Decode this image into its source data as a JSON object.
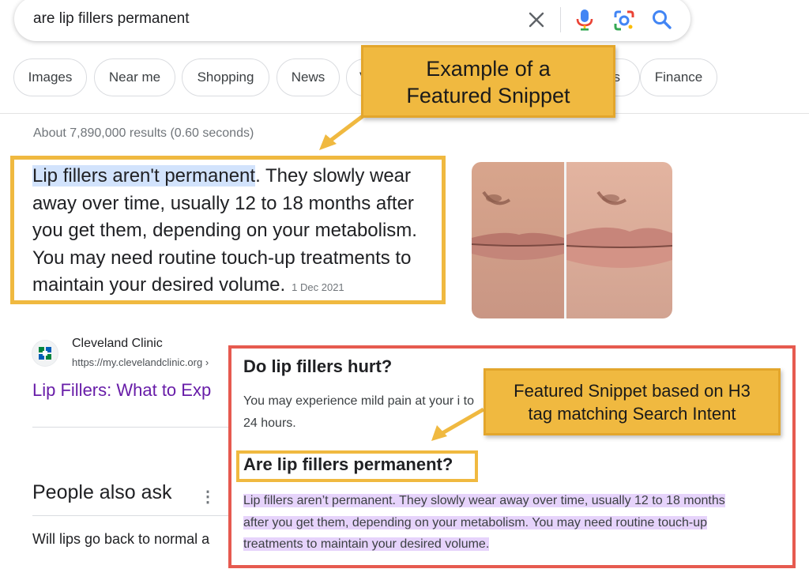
{
  "search": {
    "query": "are lip fillers permanent"
  },
  "chips": [
    "Images",
    "Near me",
    "Shopping",
    "News",
    "V",
    "s",
    "Finance"
  ],
  "result_stats": "About 7,890,000 results (0.60 seconds)",
  "callouts": {
    "top_line1": "Example of a",
    "top_line2": "Featured Snippet",
    "bottom_line1": "Featured Snippet based on H3",
    "bottom_line2": "tag matching Search Intent"
  },
  "snippet": {
    "highlight": "Lip fillers aren't permanent",
    "rest": ". They slowly wear away over time, usually 12 to 18 months after you get them, depending on your metabolism. You may need routine touch-up treatments to maintain your desired volume.",
    "date": "1 Dec 2021"
  },
  "source": {
    "site_name": "Cleveland Clinic",
    "url": "https://my.clevelandclinic.org ›",
    "link_title": "Lip Fillers: What to Exp"
  },
  "paa": {
    "title": "People also ask",
    "menu_glyph": "⋮",
    "q1": "Will lips go back to normal a"
  },
  "inset": {
    "h1": "Do lip fillers hurt?",
    "p1": "You may experience mild pain at your i to 24 hours.",
    "h2": "Are lip fillers permanent?",
    "p2_line1": "Lip fillers aren’t permanent. They slowly wear away over time, usually 12 to 18 months",
    "p2_line2": "after you get them, depending on your metabolism. You may need routine touch-up",
    "p2_line3": "treatments to maintain your desired volume."
  },
  "colors": {
    "callout": "#f0b940",
    "inset_border": "#e65a4f",
    "link": "#681da8",
    "highlight_blue": "#d2e3fc",
    "highlight_purple": "#e6d3fb"
  }
}
